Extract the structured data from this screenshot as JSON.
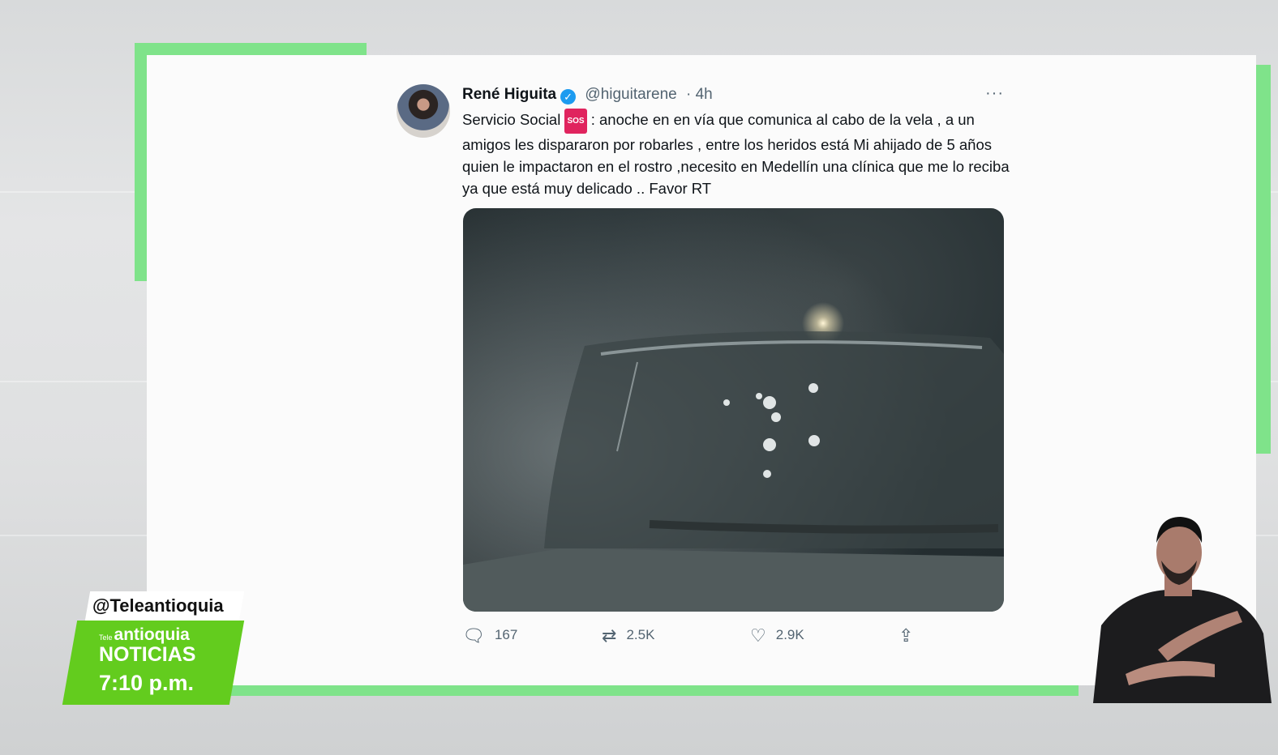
{
  "tweet": {
    "author_name": "René Higuita",
    "handle": "@higuitarene",
    "time_ago": "· 4h",
    "more_label": "···",
    "text_before": "Servicio Social",
    "sos_emoji": "SOS",
    "text_after": ": anoche en en vía que comunica al cabo de la vela , a un amigos les dispararon por robarles , entre los heridos está Mi ahijado de 5 años quien le impactaron en el rostro ,necesito en Medellín una clínica que me lo reciba ya que está muy delicado .. Favor RT",
    "replies": "167",
    "retweets": "2.5K",
    "likes": "2.9K"
  },
  "broadcast": {
    "social_handle": "@Teleantioquia",
    "brand_prefix": "Tele",
    "brand": "antioquia",
    "program": "NOTICIAS",
    "time": "7:10 p.m."
  },
  "icons": {
    "reply": "speech-bubble-icon",
    "retweet": "retweet-icon",
    "like": "heart-icon",
    "share": "share-icon",
    "verified": "verified-badge-icon"
  },
  "colors": {
    "accent_green": "#7fe38a",
    "brand_green": "#63cc1e",
    "twitter_blue": "#1d9bf0"
  }
}
